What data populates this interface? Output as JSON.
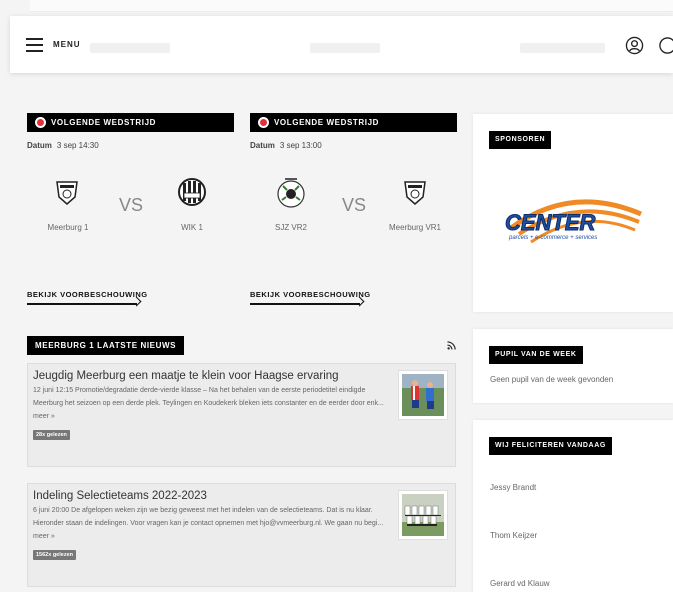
{
  "header": {
    "menu_label": "MENU",
    "icons": {
      "menu": "hamburger-icon",
      "user": "user-icon",
      "search": "search-icon"
    }
  },
  "matches": [
    {
      "label": "VOLGENDE WEDSTRIJD",
      "date_label": "Datum",
      "date_value": "3 sep 14:30",
      "vs": "VS",
      "home": "Meerburg 1",
      "away": "WIK 1",
      "preview": "BEKIJK VOORBESCHOUWING"
    },
    {
      "label": "VOLGENDE WEDSTRIJD",
      "date_label": "Datum",
      "date_value": "3 sep 13:00",
      "vs": "VS",
      "home": "SJZ VR2",
      "away": "Meerburg VR1",
      "preview": "BEKIJK VOORBESCHOUWING"
    }
  ],
  "news": {
    "section_label": "MEERBURG 1 LAATSTE NIEUWS",
    "items": [
      {
        "title": "Jeugdig Meerburg een maatje te klein voor Haagse ervaring",
        "body": "12 juni 12:15 Promotie/degradatie derde-vierde klasse – Na het behalen van de eerste periodetitel eindigde Meerburg het seizoen op een derde plek. Teylingen en Koudekerk bleken iets constanter en de eerder door enk...",
        "more": "meer »",
        "reads": "28x gelezen"
      },
      {
        "title": "Indeling Selectieteams 2022-2023",
        "body": "6 juni 20:00 De afgelopen weken zijn we bezig geweest met het indelen van de selectieteams. Dat is nu klaar. Hieronder staan de indelingen. Voor vragen kan je contact opnemen met hjo@vvmeerburg.nl. We gaan nu begi...",
        "more": "meer »",
        "reads": "1562x gelezen"
      }
    ]
  },
  "sidebar": {
    "sponsors_label": "SPONSOREN",
    "sponsor_logo_text": "CENTER",
    "sponsor_tagline": "parcels + e-commerce + services",
    "pupil_label": "PUPIL VAN DE WEEK",
    "pupil_text": "Geen pupil van de week gevonden",
    "congrats_label": "WIJ FELICITEREN VANDAAG",
    "congrats_names": [
      "Jessy Brandt",
      "Thom Keijzer",
      "Gerard vd Klauw"
    ]
  },
  "colors": {
    "accent_red": "#e42f36",
    "label_bg": "#000000",
    "sponsor_blue": "#1f4fa0",
    "sponsor_orange": "#f08a24"
  }
}
